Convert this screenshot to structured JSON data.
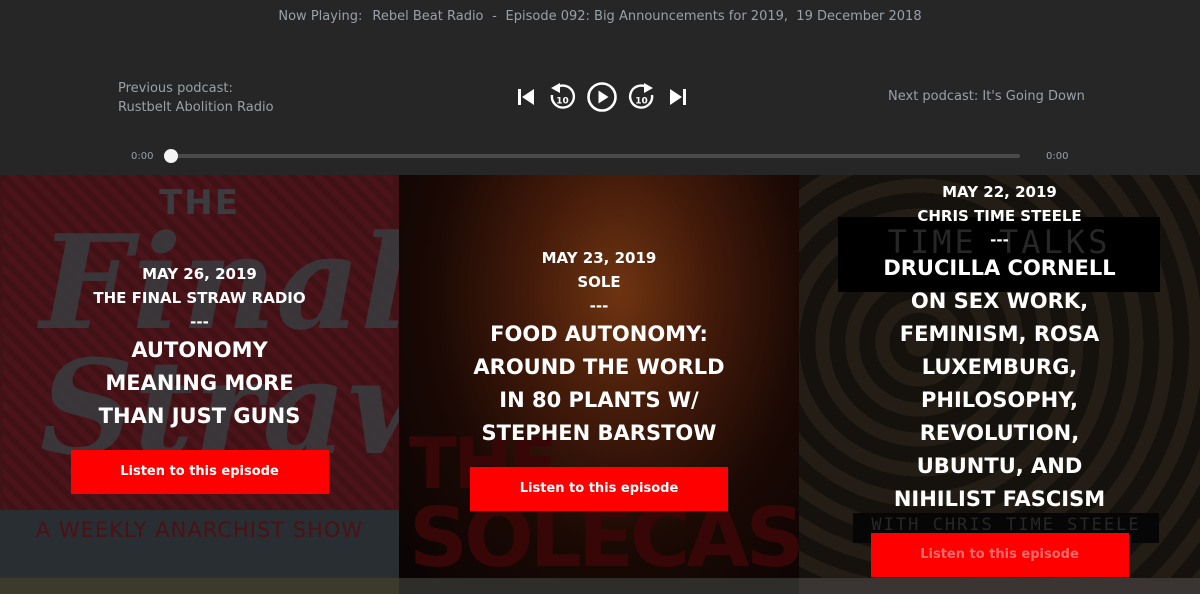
{
  "player": {
    "now_playing_label": "Now Playing:",
    "show_name": "Rebel Beat Radio",
    "separator": "-",
    "episode_title": "Episode 092: Big Announcements for 2019,",
    "episode_date": "19 December 2018",
    "previous_podcast": "Previous podcast: Rustbelt Abolition Radio",
    "next_podcast": "Next podcast: It's Going Down",
    "elapsed_time": "0:00",
    "total_time": "0:00",
    "progress": 0,
    "controls": [
      "skip-previous-icon",
      "rewind-10-icon",
      "play-icon",
      "forward-10-icon",
      "skip-next-icon"
    ],
    "rewind_seconds": "10",
    "forward_seconds": "10"
  },
  "episodes": [
    {
      "date": "MAY 26, 2019",
      "show": "THE FINAL STRAW RADIO",
      "separator": "---",
      "title": "AUTONOMY MEANING MORE THAN JUST GUNS",
      "button_label": "Listen to this episode",
      "art": {
        "top_word": "THE",
        "script_word": "Final Straw",
        "tagline": "A WEEKLY ANARCHIST SHOW"
      }
    },
    {
      "date": "MAY 23, 2019",
      "show": "SOLE",
      "separator": "---",
      "title": "FOOD AUTONOMY: AROUND THE WORLD IN 80 PLANTS W/ STEPHEN BARSTOW",
      "button_label": "Listen to this episode",
      "art": {
        "word1": "THE",
        "word2": "SOLECAST"
      }
    },
    {
      "date": "MAY 22, 2019",
      "show": "CHRIS TIME STEELE",
      "separator": "---",
      "title": "DRUCILLA CORNELL ON SEX WORK, FEMINISM, ROSA LUXEMBURG, PHILOSOPHY, REVOLUTION, UBUNTU, AND NIHILIST FASCISM",
      "button_label": "Listen to this episode",
      "art": {
        "banner": "TIME TALKS",
        "byline": "WITH CHRIS TIME STEELE"
      }
    }
  ],
  "colors": {
    "background": "#262626",
    "player_text": "#9aa0a8",
    "button": "#ff0000",
    "progress_track": "#4a4a4a"
  }
}
